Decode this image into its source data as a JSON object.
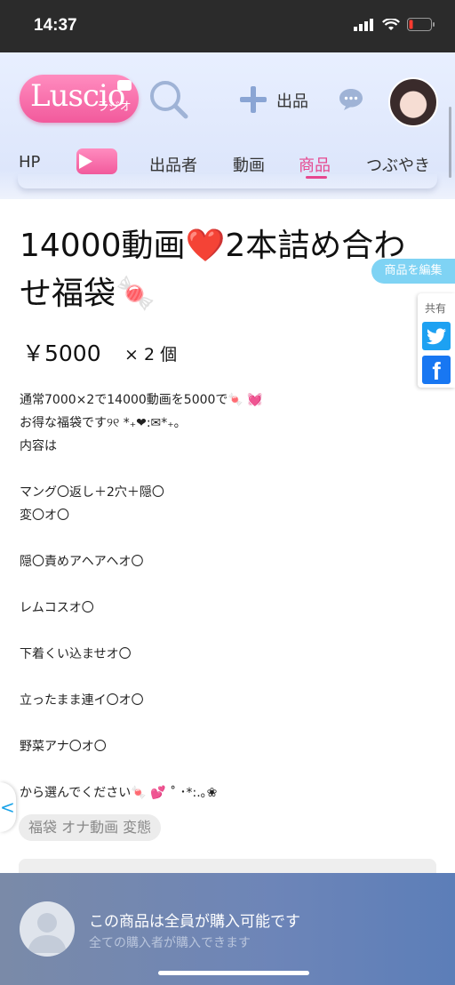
{
  "status": {
    "time": "14:37"
  },
  "header": {
    "logo_text": "Luscio",
    "logo_sub": "ラジオ",
    "sell_label": "出品"
  },
  "nav": {
    "items": [
      {
        "label": "HP"
      },
      {
        "label": "出品者"
      },
      {
        "label": "動画"
      },
      {
        "label": "商品",
        "active": true
      },
      {
        "label": "つぶやき"
      }
    ]
  },
  "product": {
    "title_line1": "14000動画❤️2本詰め合わ",
    "title_line2": "せ福袋🍬",
    "price": "￥5000",
    "quantity": "× 2 個",
    "description": [
      "通常7000×2で14000動画を5000で🍬 💓",
      "お得な福袋です୨୧ *₊❤︎:✉︎*₊。",
      "内容は",
      "",
      "マング〇返し＋2穴＋隠〇",
      "変〇オ〇",
      "",
      "隠〇責めアヘアヘオ〇",
      "",
      "レムコスオ〇",
      "",
      "下着くい込ませオ〇",
      "",
      "立ったまま連イ〇オ〇",
      "",
      "野菜アナ〇オ〇",
      "",
      "から選んでください🍬 💕 ˚ ･*:.｡❀"
    ],
    "tags": "福袋 オナ動画 変態"
  },
  "side": {
    "edit_label": "商品を編集",
    "share_label": "共有",
    "facebook_glyph": "f",
    "back_glyph": "<"
  },
  "footer": {
    "title": "この商品は全員が購入可能です",
    "subtitle": "全ての購入者が購入できます"
  },
  "colors": {
    "accent": "#e6478f",
    "twitter": "#1da1f2",
    "facebook": "#1877f2",
    "edit": "#7fd3f4"
  },
  "icons": [
    "search-icon",
    "plus-icon",
    "chat-icon",
    "twitter-icon",
    "facebook-icon",
    "signal-icon",
    "wifi-icon",
    "battery-icon"
  ]
}
